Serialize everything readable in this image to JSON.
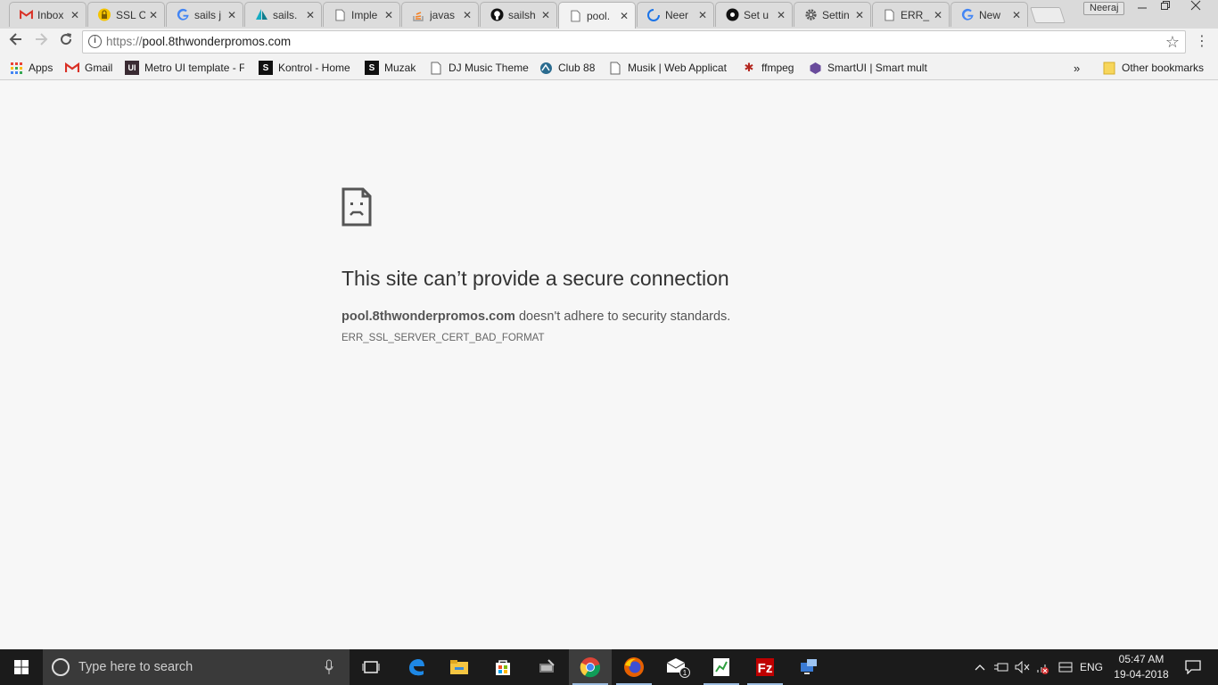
{
  "browser": {
    "tabs": [
      {
        "title": "Inbox",
        "icon": "gmail-icon",
        "active": false
      },
      {
        "title": "SSL C",
        "icon": "lock-icon",
        "active": false
      },
      {
        "title": "sails j",
        "icon": "google-icon",
        "active": false
      },
      {
        "title": "sails.",
        "icon": "sails-icon",
        "active": false
      },
      {
        "title": "Imple",
        "icon": "page-icon",
        "active": false
      },
      {
        "title": "javas",
        "icon": "stackoverflow-icon",
        "active": false
      },
      {
        "title": "sailsh",
        "icon": "github-icon",
        "active": false
      },
      {
        "title": "pool.",
        "icon": "page-icon",
        "active": true
      },
      {
        "title": "Neer",
        "icon": "loading-icon",
        "active": false
      },
      {
        "title": "Set u",
        "icon": "circle-icon",
        "active": false
      },
      {
        "title": "Settin",
        "icon": "gear-icon",
        "active": false
      },
      {
        "title": "ERR_",
        "icon": "page-icon",
        "active": false
      },
      {
        "title": "New",
        "icon": "google-icon",
        "active": false
      }
    ],
    "profile_name": "Neeraj",
    "url_scheme": "https://",
    "url_host": "pool.8thwonderpromos.com"
  },
  "bookmarks": [
    {
      "label": "Apps",
      "icon": "apps-icon"
    },
    {
      "label": "Gmail",
      "icon": "gmail-icon"
    },
    {
      "label": "Metro UI template - F",
      "icon": "metro-ui-icon"
    },
    {
      "label": "Kontrol - Home",
      "icon": "s-icon"
    },
    {
      "label": "Muzak",
      "icon": "s-icon"
    },
    {
      "label": "DJ Music Theme",
      "icon": "page-icon"
    },
    {
      "label": "Club 88",
      "icon": "club-icon"
    },
    {
      "label": "Musik | Web Applicat",
      "icon": "page-icon"
    },
    {
      "label": "ffmpeg",
      "icon": "ffmpeg-icon"
    },
    {
      "label": "SmartUI | Smart mult",
      "icon": "smartui-icon"
    }
  ],
  "bookmarks_overflow": "»",
  "other_bookmarks": "Other bookmarks",
  "error": {
    "title": "This site can’t provide a secure connection",
    "host": "pool.8thwonderpromos.com",
    "description_rest": " doesn't adhere to security standards.",
    "code": "ERR_SSL_SERVER_CERT_BAD_FORMAT"
  },
  "taskbar": {
    "search_placeholder": "Type here to search",
    "language": "ENG",
    "time": "05:47 AM",
    "date": "19-04-2018",
    "mail_badge": "1"
  },
  "colors": {
    "accent_blue": "#1a73e8",
    "taskbar": "#1b1b1b",
    "page_bg": "#f7f7f7"
  }
}
